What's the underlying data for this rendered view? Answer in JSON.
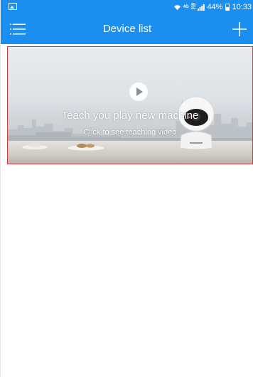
{
  "status_bar": {
    "network_4g": "4G",
    "network_stack_top": "4G",
    "network_stack_bottom": "2G",
    "battery": "44%",
    "time": "10:33"
  },
  "header": {
    "title": "Device list",
    "menu_icon": "menu-icon",
    "add_icon": "plus-icon"
  },
  "banner": {
    "title": "Teach you play new machine",
    "subtitle": "Click to see teaching video",
    "play_icon": "play-icon"
  },
  "colors": {
    "accent": "#1b8ff0",
    "banner_border": "#d23b3b"
  }
}
